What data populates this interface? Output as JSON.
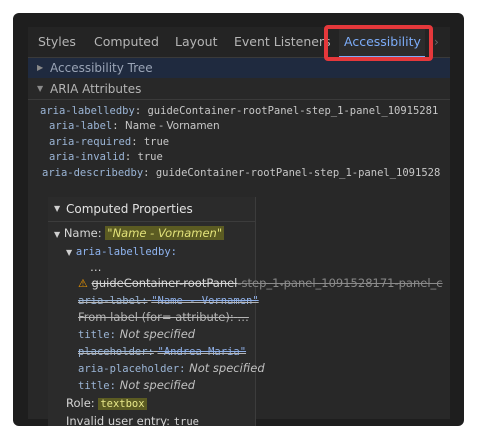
{
  "tabs": [
    "Styles",
    "Computed",
    "Layout",
    "Event Listeners",
    "Accessibility"
  ],
  "tab_overflow_icon": "chevron-right-icon",
  "sections": {
    "tree": "Accessibility Tree",
    "attrs": "ARIA Attributes"
  },
  "aria_attributes": [
    {
      "key": "aria-labelledby",
      "value": "guideContainer-rootPanel-step_1-panel_10915281"
    },
    {
      "key": "aria-label",
      "value": "Name - Vornamen"
    },
    {
      "key": "aria-required",
      "value": "true"
    },
    {
      "key": "aria-invalid",
      "value": "true"
    },
    {
      "key": "aria-describedby",
      "value": "guideContainer-rootPanel-step_1-panel_1091528"
    }
  ],
  "computed": {
    "title": "Computed Properties",
    "name_label": "Name:",
    "name_value": "\"Name - Vornamen\"",
    "labelledby_key": "aria-labelledby:",
    "ellipsis": "…",
    "labelledby_ref_hl": "guideContainer-rootPanel",
    "labelledby_ref_rest": "-step_1-panel_1091528171-panel_c",
    "labelledby_more": "…",
    "aria_label_key": "aria-label:",
    "aria_label_val": "\"Name - Vornamen\"",
    "from_label": "From label (for= attribute):",
    "from_label_more": "…",
    "title_key": "title:",
    "not_specified": "Not specified",
    "placeholder_key": "placeholder:",
    "placeholder_val": "\"Andrea Maria\"",
    "aria_placeholder_key": "aria-placeholder:",
    "role_label": "Role:",
    "role_value": "textbox",
    "invalid_label": "Invalid user entry:",
    "invalid_value": "true"
  },
  "colors": {
    "highlight_box": "#e5383b",
    "accent": "#7cacf8"
  }
}
